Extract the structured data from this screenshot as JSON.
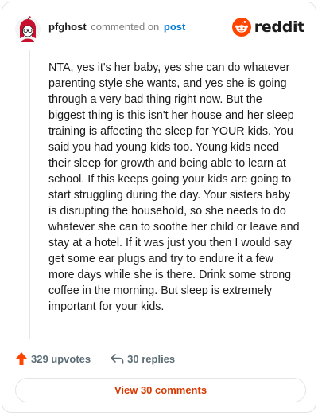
{
  "header": {
    "username": "pfghost",
    "action_text": "commented on",
    "target_text": "post",
    "brand_name": "reddit"
  },
  "comment": {
    "body": "NTA, yes it's her baby, yes she can do whatever parenting style she wants, and yes she is going through a very bad thing right now. But the biggest thing is this isn't her house and her sleep training is affecting the sleep for YOUR kids. You said you had young kids too. Young kids need their sleep for growth and being able to learn at school. If this keeps going your kids are going to start struggling during the day. Your sisters baby is disrupting the household, so she needs to do whatever she can to soothe her child or leave and stay at a hotel. If it was just you then I would say get some ear plugs and try to endure it a few more days while she is there. Drink some strong coffee in the morning. But sleep is extremely important for your kids."
  },
  "footer": {
    "upvotes_text": "329 upvotes",
    "replies_text": "30 replies",
    "view_button_label": "View 30 comments"
  },
  "colors": {
    "brand_orange": "#ff4500",
    "link_blue": "#0079d3",
    "button_text": "#d93900"
  },
  "icons": {
    "avatar": "snoo-avatar-red-hair",
    "brand": "reddit-snoo-icon",
    "upvote": "upvote-arrow-icon",
    "reply": "reply-arrow-icon"
  }
}
